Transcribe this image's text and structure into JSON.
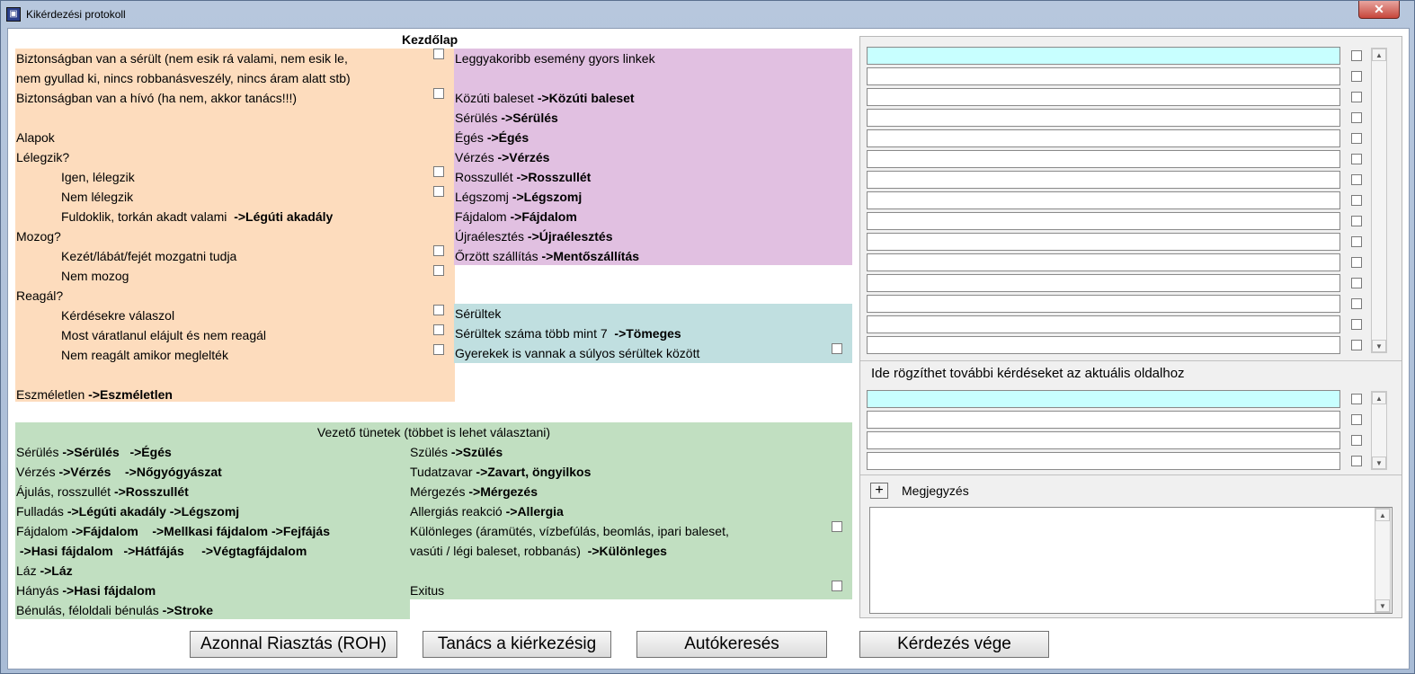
{
  "window": {
    "title": "Kikérdezési protokoll",
    "close_label": "✕"
  },
  "main_heading": "Kezdőlap",
  "safety": {
    "q1_line1": "Biztonságban van a sérült (nem esik rá valami, nem esik le,",
    "q1_line2": "nem gyullad ki, nincs robbanásveszély, nincs áram alatt stb)",
    "q2": "Biztonságban van a hívó (ha nem, akkor tanács!!!)"
  },
  "basics": {
    "title": "Alapok",
    "breathing_q": "Lélegzik?",
    "breathing_yes": "Igen, lélegzik",
    "breathing_no": "Nem lélegzik",
    "choking": "Fuldoklik, torkán akadt valami",
    "choking_link": "->Légúti akadály",
    "moving_q": "Mozog?",
    "moving_yes": "Kezét/lábát/fejét mozgatni tudja",
    "moving_no": "Nem mozog",
    "react_q": "Reagál?",
    "react_1": "Kérdésekre válaszol",
    "react_2": "Most váratlanul elájult és nem reagál",
    "react_3": "Nem reagált amikor meglelték",
    "unconscious": "Eszméletlen",
    "unconscious_link": "->Eszméletlen"
  },
  "quicklinks": {
    "title": "Leggyakoribb esemény gyors linkek",
    "items": [
      {
        "label": "Közúti baleset",
        "link": "->Közúti baleset"
      },
      {
        "label": "Sérülés",
        "link": "->Sérülés"
      },
      {
        "label": "Égés",
        "link": "->Égés"
      },
      {
        "label": "Vérzés",
        "link": "->Vérzés"
      },
      {
        "label": "Rosszullét",
        "link": "->Rosszullét"
      },
      {
        "label": "Légszomj",
        "link": "->Légszomj"
      },
      {
        "label": "Fájdalom",
        "link": "->Fájdalom"
      },
      {
        "label": "Újraélesztés",
        "link": "->Újraélesztés"
      },
      {
        "label": "Őrzött szállítás",
        "link": "->Mentőszállítás"
      }
    ]
  },
  "injured": {
    "title": "Sérültek",
    "count_label": "Sérültek száma több mint 7",
    "count_link": "->Tömeges",
    "children": "Gyerekek is vannak a súlyos sérültek között"
  },
  "symptoms": {
    "title": "Vezető tünetek (többet is lehet választani)",
    "left": {
      "r1_label": "Sérülés",
      "r1_link1": "->Sérülés",
      "r1_link2": "->Égés",
      "r2_label": "Vérzés",
      "r2_link1": "->Vérzés",
      "r2_link2": "->Nőgyógyászat",
      "r3_label": "Ájulás, rosszullét",
      "r3_link1": "->Rosszullét",
      "r4_label": "Fulladás",
      "r4_link1": "->Légúti akadály",
      "r4_link2": "->Légszomj",
      "r5_label": "Fájdalom",
      "r5_link1": "->Fájdalom",
      "r5_link2": "->Mellkasi fájdalom",
      "r5_link3": "->Fejfájás",
      "r6_link1": "->Hasi fájdalom",
      "r6_link2": "->Hátfájás",
      "r6_link3": "->Végtagfájdalom",
      "r7_label": "Láz",
      "r7_link1": "->Láz",
      "r8_label": "Hányás",
      "r8_link1": "->Hasi fájdalom",
      "r9_label": "Bénulás, féloldali bénulás",
      "r9_link1": "->Stroke"
    },
    "right": {
      "r1_label": "Szülés",
      "r1_link": "->Szülés",
      "r2_label": "Tudatzavar",
      "r2_link": "->Zavart, öngyilkos",
      "r3_label": "Mérgezés",
      "r3_link": "->Mérgezés",
      "r4_label": "Allergiás reakció",
      "r4_link": "->Allergia",
      "r5_line1": "Különleges (áramütés, vízbefúlás, beomlás, ipari baleset,",
      "r5_line2": "vasúti / légi baleset, robbanás)",
      "r5_link": "->Különleges",
      "r6_label": "Exitus"
    }
  },
  "right_panel": {
    "extra_questions_label": "Ide rögzíthet további kérdéseket az aktuális oldalhoz",
    "plus_label": "+",
    "note_label": "Megjegyzés",
    "note_value": ""
  },
  "buttons": {
    "alarm": "Azonnal Riasztás (ROH)",
    "advice": "Tanács a kiérkezésig",
    "autosearch": "Autókeresés",
    "end": "Kérdezés vége"
  },
  "colors": {
    "orange": "#fddcbd",
    "purple": "#e1c0e1",
    "teal": "#c0dfe0",
    "green": "#c1dfc1",
    "active_field": "#c8ffff"
  }
}
